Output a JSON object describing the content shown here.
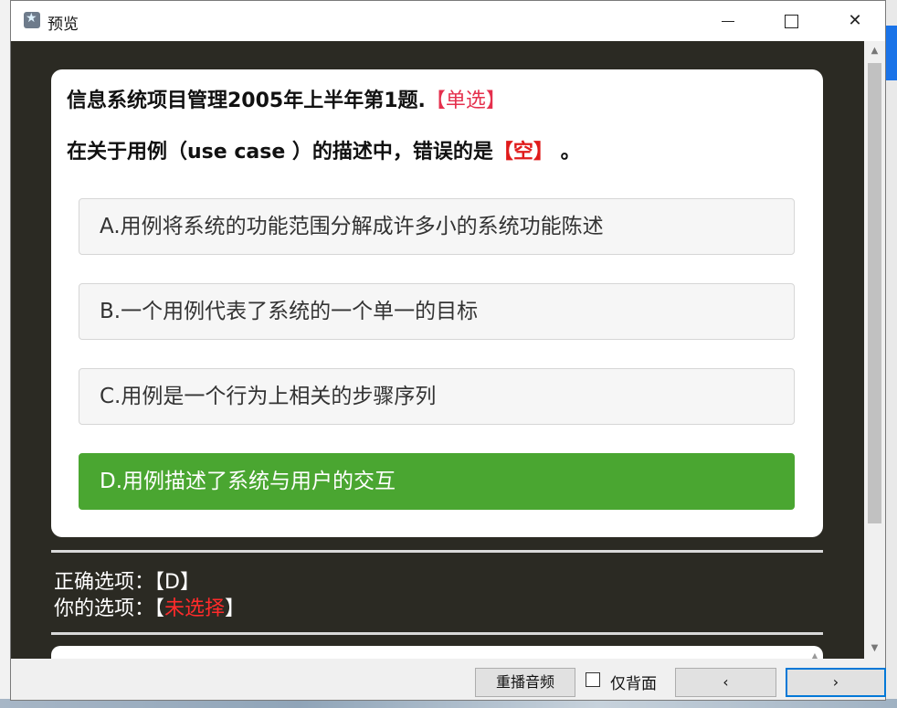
{
  "window": {
    "title": "预览",
    "controls": {
      "minimize": "minimize",
      "maximize": "maximize",
      "close": "✕"
    }
  },
  "question": {
    "header": "信息系统项目管理2005年上半年第1题.",
    "type_tag": "【单选】",
    "text_before": "在关于用例（use case ）的描述中，错误的是",
    "blank": "【空】",
    "text_after": " 。",
    "options": [
      {
        "label": "A.用例将系统的功能范围分解成许多小的系统功能陈述",
        "selected": false
      },
      {
        "label": "B.一个用例代表了系统的一个单一的目标",
        "selected": false
      },
      {
        "label": "C.用例是一个行为上相关的步骤序列",
        "selected": false
      },
      {
        "label": "D.用例描述了系统与用户的交互",
        "selected": true
      }
    ]
  },
  "answer": {
    "correct_label": "正确选项：",
    "correct_value": "【D】",
    "yours_label": "你的选项：",
    "yours_open": "【",
    "yours_value": "未选择",
    "yours_close": "】"
  },
  "footer": {
    "replay_label": "重播音频",
    "back_only_label": "仅背面",
    "prev_label": "‹",
    "next_label": "›"
  },
  "colors": {
    "content_bg": "#2b2a23",
    "selected_option": "#4aa631",
    "tag_red": "#e5304d",
    "focus_blue": "#0078d7"
  },
  "icons": {
    "app": "star-app-icon",
    "scroll_up": "▲",
    "scroll_down": "▼",
    "mini_scroll": "▲"
  }
}
